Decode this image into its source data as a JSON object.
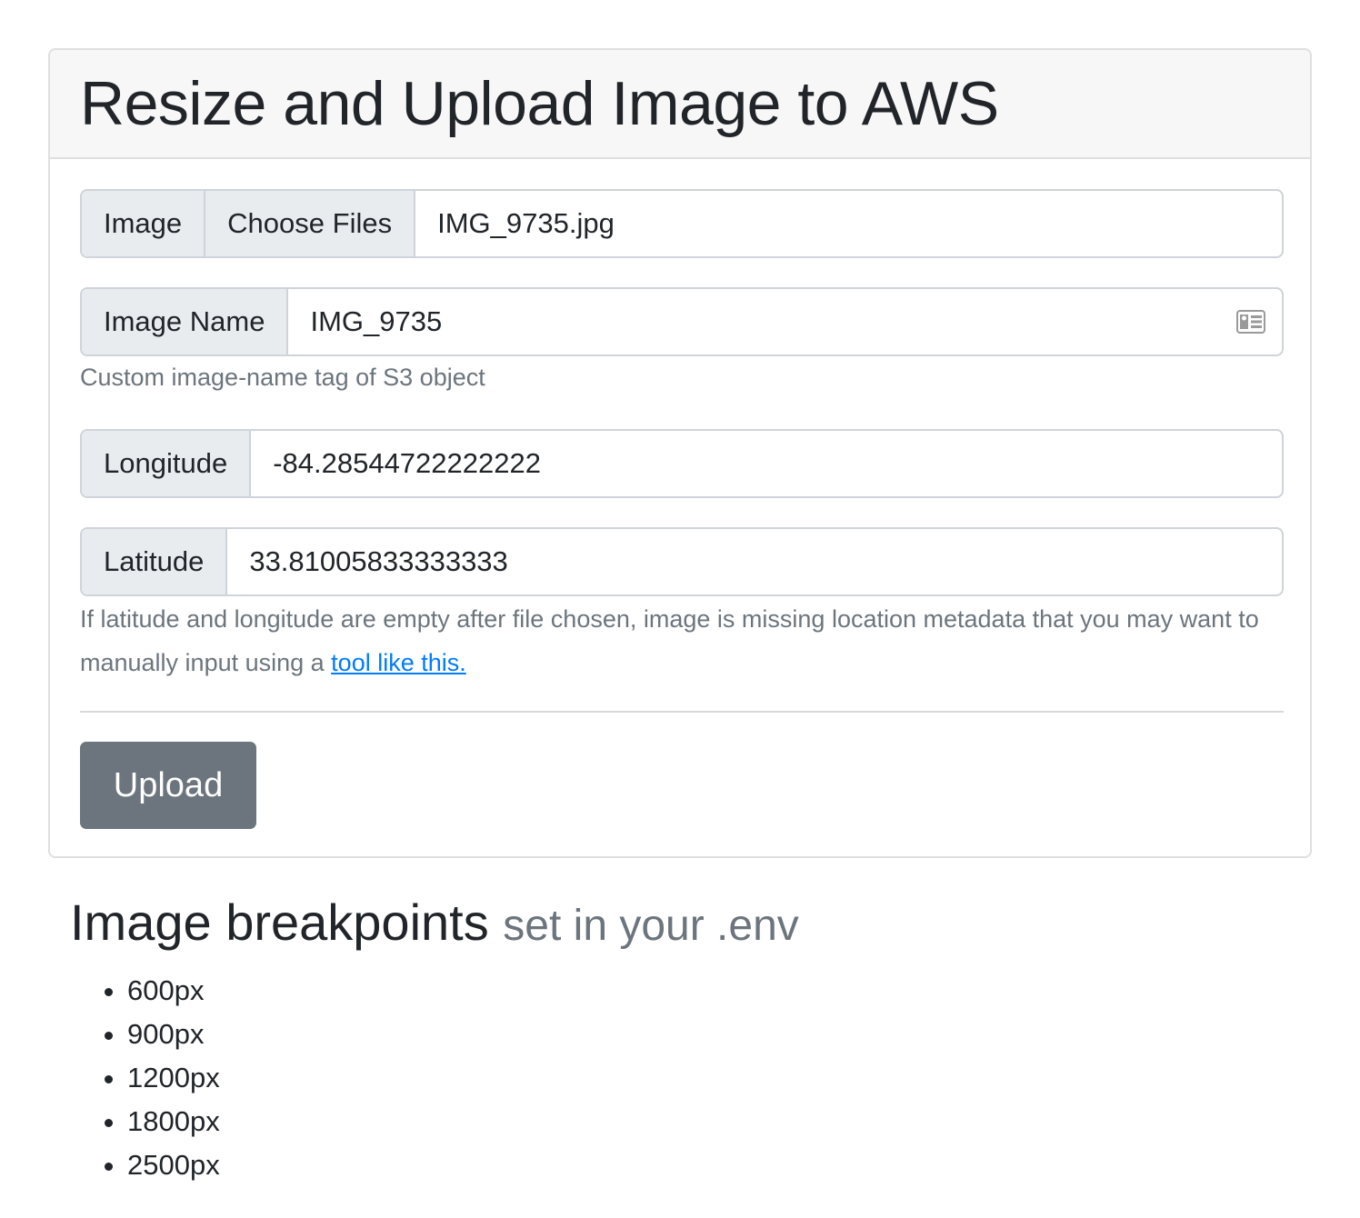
{
  "header": {
    "title": "Resize and Upload Image to AWS"
  },
  "image_field": {
    "label": "Image",
    "button_label": "Choose Files",
    "file_name": "IMG_9735.jpg"
  },
  "image_name_field": {
    "label": "Image Name",
    "value": "IMG_9735",
    "help": "Custom image-name tag of S3 object",
    "icon": "contact-card-icon"
  },
  "longitude_field": {
    "label": "Longitude",
    "value": "-84.28544722222222"
  },
  "latitude_field": {
    "label": "Latitude",
    "value": "33.81005833333333",
    "help_prefix": "If latitude and longitude are empty after file chosen, image is missing location metadata that you may want to manually input using a ",
    "help_link": "tool like this."
  },
  "upload_button": {
    "label": "Upload",
    "color": "#6c757d"
  },
  "breakpoints": {
    "title": "Image breakpoints",
    "subtitle": "set in your .env",
    "items": [
      "600px",
      "900px",
      "1200px",
      "1800px",
      "2500px"
    ]
  },
  "colors": {
    "link": "#007bff",
    "muted": "#6c757d",
    "addon_bg": "#e9ecef",
    "border": "#ced4da"
  }
}
